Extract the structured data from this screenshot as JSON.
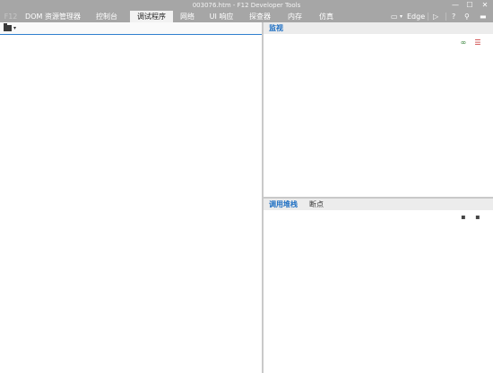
{
  "window": {
    "title": "003076.htm - F12 Developer Tools",
    "minimize_glyph": "—",
    "maximize_glyph": "☐",
    "close_glyph": "✕"
  },
  "tabs": [
    {
      "label": "F12"
    },
    {
      "label": "DOM 资源管理器"
    },
    {
      "label": "控制台"
    },
    {
      "label": "调试程序"
    },
    {
      "label": "网络"
    },
    {
      "label": "UI 响应"
    },
    {
      "label": "探查器"
    },
    {
      "label": "内存"
    },
    {
      "label": "仿真"
    }
  ],
  "toolbar_right": {
    "emulation_mode": "Edge",
    "screen_icon_glyph": "▭",
    "dropdown_glyph": "▾",
    "console_icon_glyph": "▷",
    "help_label": "?",
    "pin_icon_glyph": "⚲",
    "dock_icon_glyph": "▬"
  },
  "left_pane": {
    "dropdown_glyph": "▾"
  },
  "watch_pane": {
    "tab_label": "监视",
    "add_watch_glyph": "∞",
    "delete_watch_glyph": "☰"
  },
  "callstack_pane": {
    "tabs": [
      {
        "label": "调用堆栈"
      },
      {
        "label": "断点"
      }
    ],
    "icon1_glyph": "▪",
    "icon2_glyph": "▪"
  }
}
